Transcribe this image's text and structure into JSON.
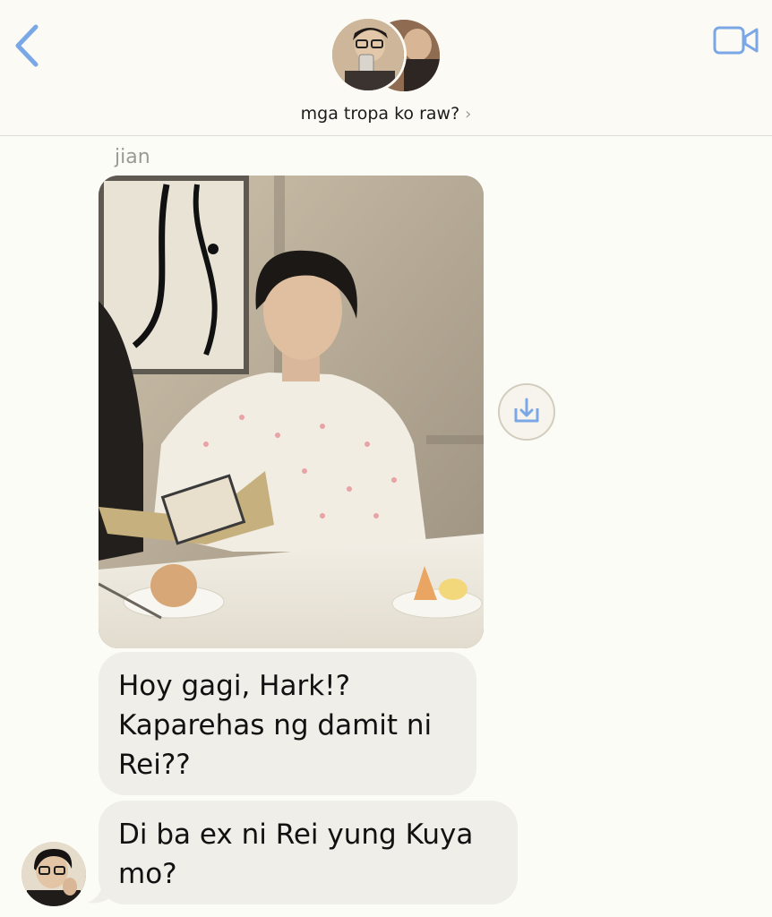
{
  "header": {
    "group_name": "mga tropa ko raw?",
    "chevron": "›",
    "back_icon": "chevron-left-icon",
    "video_icon": "video-camera-icon",
    "accent": "#7aa7e6"
  },
  "thread": {
    "sender_name": "jian",
    "photo_alt": "photo attachment",
    "save_icon": "save-to-photos-icon",
    "messages": [
      {
        "text": "Hoy gagi, Hark!?\nKaparehas ng damit ni\nRei??"
      },
      {
        "text": "Di ba ex ni Rei yung Kuya\nmo?"
      }
    ],
    "bubble_color": "#efeee8"
  }
}
